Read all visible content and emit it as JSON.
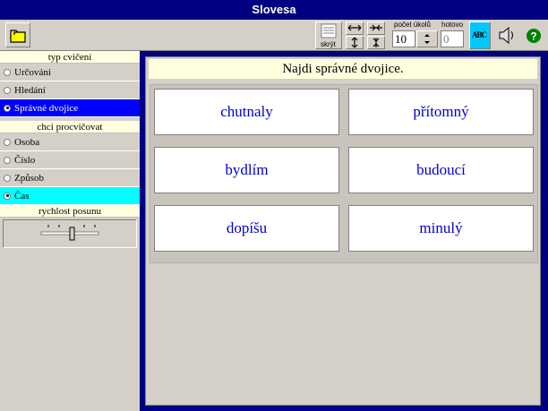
{
  "window": {
    "title": "Slovesa"
  },
  "toolbar": {
    "hide_label": "skrýt",
    "task_count_label": "počet úkolů",
    "task_count_value": "10",
    "done_label": "hotovo",
    "done_value": "0",
    "spell_icon_text": "ABC"
  },
  "sidebar": {
    "exercise_type_heading": "typ cvičení",
    "exercise_types": [
      {
        "label": "Určování",
        "selected": false
      },
      {
        "label": "Hledání",
        "selected": false
      },
      {
        "label": "Správné dvojice",
        "selected": true
      }
    ],
    "practice_heading": "chci procvičovat",
    "practice_options": [
      {
        "label": "Osoba",
        "selected": false
      },
      {
        "label": "Číslo",
        "selected": false
      },
      {
        "label": "Způsob",
        "selected": false
      },
      {
        "label": "Čas",
        "selected": true
      }
    ],
    "speed_heading": "rychlost posunu"
  },
  "main": {
    "instruction": "Najdi správné dvojice.",
    "pairs_left": [
      "chutnaly",
      "bydlím",
      "dopíšu"
    ],
    "pairs_right": [
      "přítomný",
      "budoucí",
      "minulý"
    ]
  }
}
